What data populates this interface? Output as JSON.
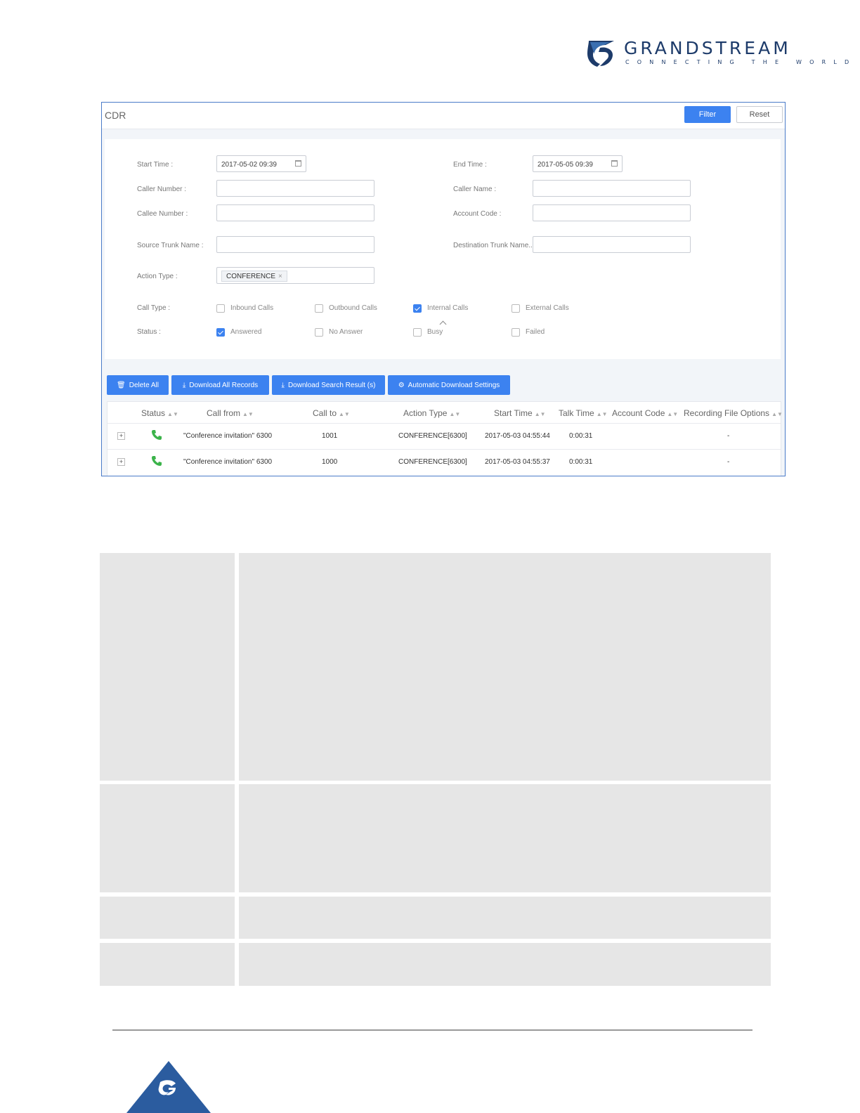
{
  "brand": {
    "name": "GRANDSTREAM",
    "tagline": "CONNECTING THE WORLD"
  },
  "cdr": {
    "title": "CDR",
    "filter_label": "Filter",
    "reset_label": "Reset",
    "form": {
      "start_time_label": "Start Time :",
      "start_time_value": "2017-05-02 09:39",
      "end_time_label": "End Time :",
      "end_time_value": "2017-05-05 09:39",
      "caller_number_label": "Caller Number :",
      "caller_name_label": "Caller Name :",
      "callee_number_label": "Callee Number :",
      "account_code_label": "Account Code :",
      "source_trunk_label": "Source Trunk Name :",
      "dest_trunk_label": "Destination Trunk Name...",
      "action_type_label": "Action Type :",
      "action_type_tag": "CONFERENCE",
      "action_type_tag_remove": "×",
      "call_type_label": "Call Type :",
      "call_types": [
        {
          "label": "Inbound Calls",
          "checked": false
        },
        {
          "label": "Outbound Calls",
          "checked": false
        },
        {
          "label": "Internal Calls",
          "checked": true
        },
        {
          "label": "External Calls",
          "checked": false
        }
      ],
      "status_label": "Status :",
      "statuses": [
        {
          "label": "Answered",
          "checked": true
        },
        {
          "label": "No Answer",
          "checked": false
        },
        {
          "label": "Busy",
          "checked": false
        },
        {
          "label": "Failed",
          "checked": false
        }
      ]
    },
    "actions": {
      "delete_all": "Delete All",
      "download_all": "Download All Records",
      "download_search": "Download Search Result (s)",
      "auto_download": "Automatic Download Settings"
    },
    "columns": [
      "Status",
      "Call from",
      "Call to",
      "Action Type",
      "Start Time",
      "Talk Time",
      "Account Code",
      "Recording File Options"
    ],
    "rows": [
      {
        "status": "answered",
        "call_from": "\"Conference invitation\" 6300",
        "call_to": "1001",
        "action_type": "CONFERENCE[6300]",
        "start_time": "2017-05-03 04:55:44",
        "talk_time": "0:00:31",
        "account_code": "",
        "recording": "-"
      },
      {
        "status": "answered",
        "call_from": "\"Conference invitation\" 6300",
        "call_to": "1000",
        "action_type": "CONFERENCE[6300]",
        "start_time": "2017-05-03 04:55:37",
        "talk_time": "0:00:31",
        "account_code": "",
        "recording": "-"
      }
    ],
    "expand_symbol": "+"
  },
  "colors": {
    "accent": "#3c82f0",
    "brand": "#1d3b6a",
    "answered": "#3bb34a",
    "table_fill": "#e6e6e6"
  }
}
